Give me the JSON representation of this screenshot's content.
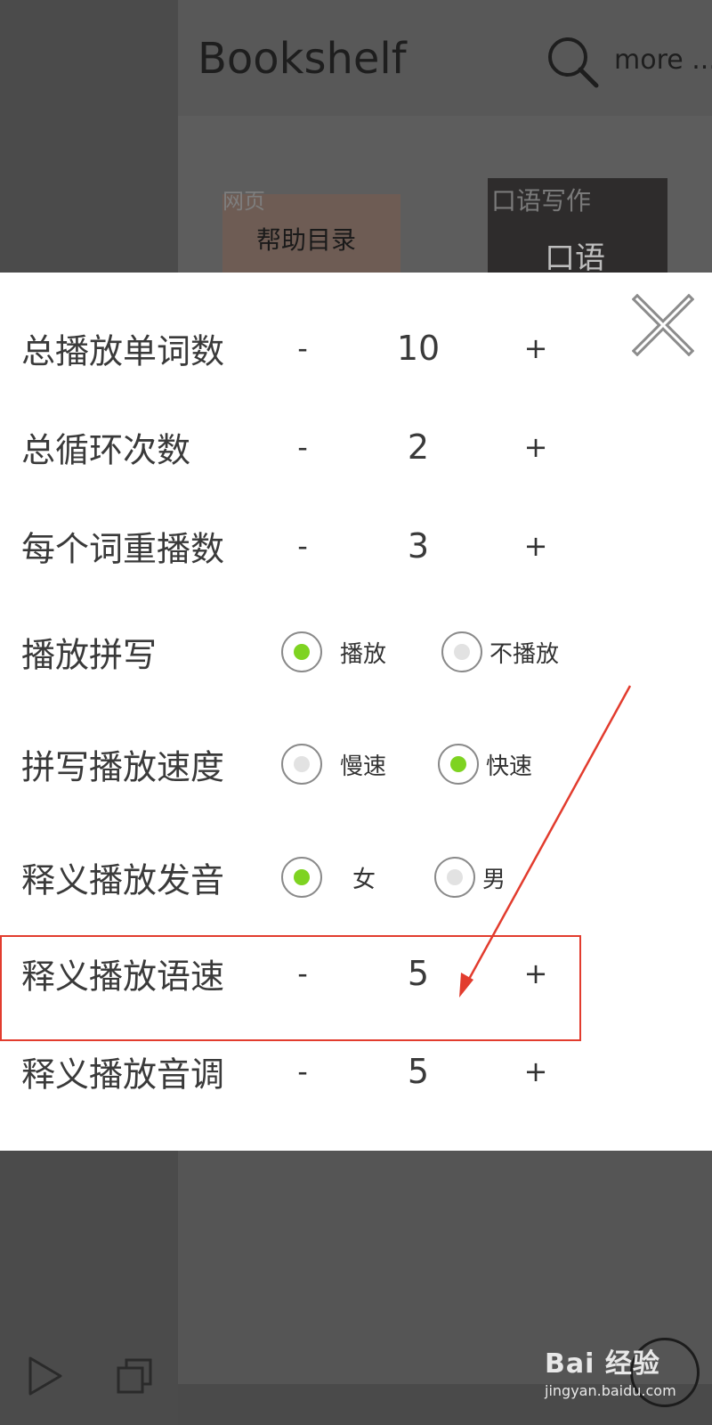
{
  "header": {
    "title": "Bookshelf",
    "more_label": "more ..."
  },
  "books": [
    {
      "tag": "网页",
      "title": "帮助目录"
    },
    {
      "tag": "口语写作",
      "title": "口语"
    }
  ],
  "settings": {
    "total_words": {
      "label": "总播放单词数",
      "minus": "-",
      "value": "10",
      "plus": "+"
    },
    "total_loops": {
      "label": "总循环次数",
      "minus": "-",
      "value": "2",
      "plus": "+"
    },
    "repeat_per_word": {
      "label": "每个词重播数",
      "minus": "-",
      "value": "3",
      "plus": "+"
    },
    "play_spelling": {
      "label": "播放拼写",
      "options": [
        {
          "label": "播放",
          "selected": true
        },
        {
          "label": "不播放",
          "selected": false
        }
      ]
    },
    "spelling_speed": {
      "label": "拼写播放速度",
      "options": [
        {
          "label": "慢速",
          "selected": false
        },
        {
          "label": "快速",
          "selected": true
        }
      ]
    },
    "definition_voice": {
      "label": "释义播放发音",
      "options": [
        {
          "label": "女",
          "selected": true
        },
        {
          "label": "男",
          "selected": false
        }
      ]
    },
    "definition_speed": {
      "label": "释义播放语速",
      "minus": "-",
      "value": "5",
      "plus": "+"
    },
    "definition_pitch": {
      "label": "释义播放音调",
      "minus": "-",
      "value": "5",
      "plus": "+"
    }
  },
  "watermark": {
    "main": "Bai 经验",
    "sub": "jingyan.baidu.com"
  },
  "colors": {
    "radio_selected": "#7ed321",
    "annotation_red": "#e23c2e",
    "overlay": "#4a4a4a"
  },
  "icons": [
    "search-icon",
    "close-icon",
    "play-icon",
    "copy-icon"
  ]
}
